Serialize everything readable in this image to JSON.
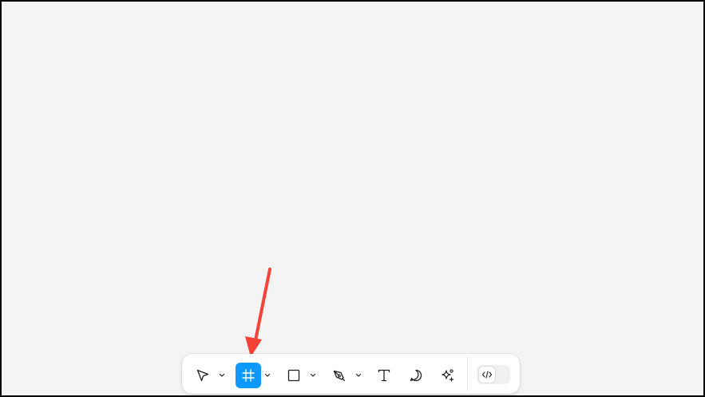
{
  "canvas": {
    "background": "#f4f4f4",
    "frame_border": "#000000"
  },
  "annotation": {
    "arrow_color": "#f44336"
  },
  "toolbar": {
    "background": "#ffffff",
    "active_color": "#0d99ff",
    "icon_color": "#1e1e1e",
    "tools": [
      {
        "name": "move",
        "icon": "cursor-arrow-icon",
        "has_menu": true,
        "active": false
      },
      {
        "name": "frame",
        "icon": "frame-hash-icon",
        "has_menu": true,
        "active": true
      },
      {
        "name": "shape",
        "icon": "rectangle-icon",
        "has_menu": true,
        "active": false
      },
      {
        "name": "pen",
        "icon": "pen-icon",
        "has_menu": true,
        "active": false
      },
      {
        "name": "text",
        "icon": "text-icon",
        "has_menu": false,
        "active": false
      },
      {
        "name": "comment",
        "icon": "comment-bubble-icon",
        "has_menu": false,
        "active": false
      },
      {
        "name": "actions",
        "icon": "sparkle-icon",
        "has_menu": false,
        "active": false
      }
    ],
    "dev_mode": {
      "icon": "code-brackets-icon",
      "enabled": false
    }
  }
}
